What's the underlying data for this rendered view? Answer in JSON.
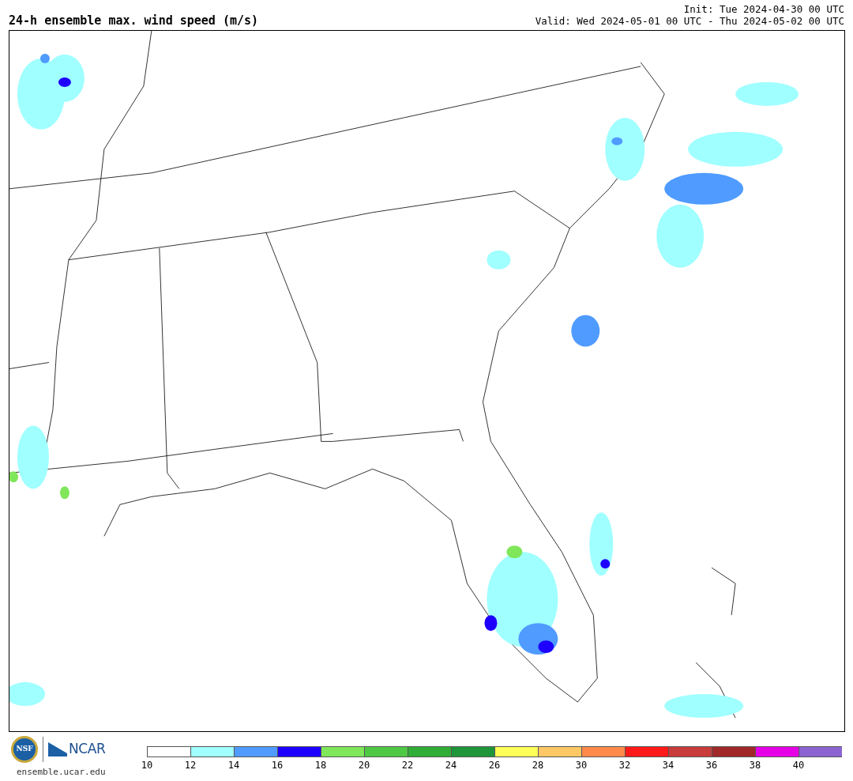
{
  "title": "24-h ensemble max. wind speed (m/s)",
  "init": "Init: Tue 2024-04-30 00 UTC",
  "valid": "Valid: Wed 2024-05-01 00 UTC - Thu 2024-05-02 00 UTC",
  "logos": {
    "seal_text": "NSF",
    "org": "NCAR",
    "site": "ensemble.ucar.edu"
  },
  "colorbar": {
    "segments": [
      {
        "color": "#ffffff",
        "tick": "10"
      },
      {
        "color": "#a0ffff",
        "tick": "12"
      },
      {
        "color": "#4f9bff",
        "tick": "14"
      },
      {
        "color": "#1e00ff",
        "tick": "16"
      },
      {
        "color": "#80e65a",
        "tick": "18"
      },
      {
        "color": "#4fc843",
        "tick": "20"
      },
      {
        "color": "#30ad36",
        "tick": "22"
      },
      {
        "color": "#1f953a",
        "tick": "24"
      },
      {
        "color": "#ffff5a",
        "tick": "26"
      },
      {
        "color": "#ffc864",
        "tick": "28"
      },
      {
        "color": "#ff8a4a",
        "tick": "30"
      },
      {
        "color": "#ff1a1a",
        "tick": "32"
      },
      {
        "color": "#c83c3c",
        "tick": "34"
      },
      {
        "color": "#a02828",
        "tick": "36"
      },
      {
        "color": "#e600e6",
        "tick": "38"
      },
      {
        "color": "#8c64d2",
        "tick": "40"
      }
    ]
  }
}
